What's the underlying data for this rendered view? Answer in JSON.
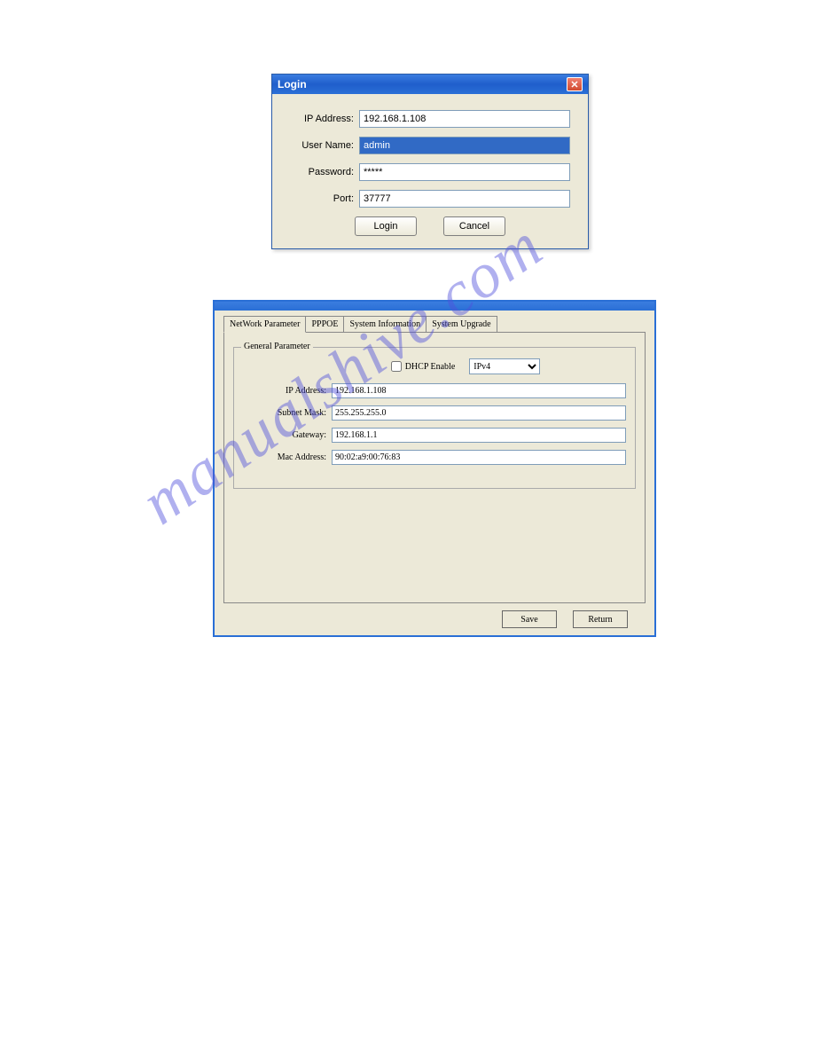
{
  "watermark_text": "manualshive.com",
  "login": {
    "title": "Login",
    "fields": {
      "ip_label": "IP Address:",
      "ip_value": "192.168.1.108",
      "user_label": "User Name:",
      "user_value": "admin",
      "pass_label": "Password:",
      "pass_value": "*****",
      "port_label": "Port:",
      "port_value": "37777"
    },
    "buttons": {
      "login": "Login",
      "cancel": "Cancel"
    }
  },
  "config": {
    "tabs": {
      "network": "NetWork Parameter",
      "pppoe": "PPPOE",
      "sysinfo": "System Information",
      "sysupgrade": "System Upgrade"
    },
    "group_legend": "General Parameter",
    "dhcp_label": "DHCP Enable",
    "ip_version": "IPv4",
    "fields": {
      "ip_label": "IP Address:",
      "ip_value": "192.168.1.108",
      "subnet_label": "Subnet Mask:",
      "subnet_value": "255.255.255.0",
      "gateway_label": "Gateway:",
      "gateway_value": "192.168.1.1",
      "mac_label": "Mac Address:",
      "mac_value": "90:02:a9:00:76:83"
    },
    "buttons": {
      "save": "Save",
      "return": "Return"
    }
  }
}
